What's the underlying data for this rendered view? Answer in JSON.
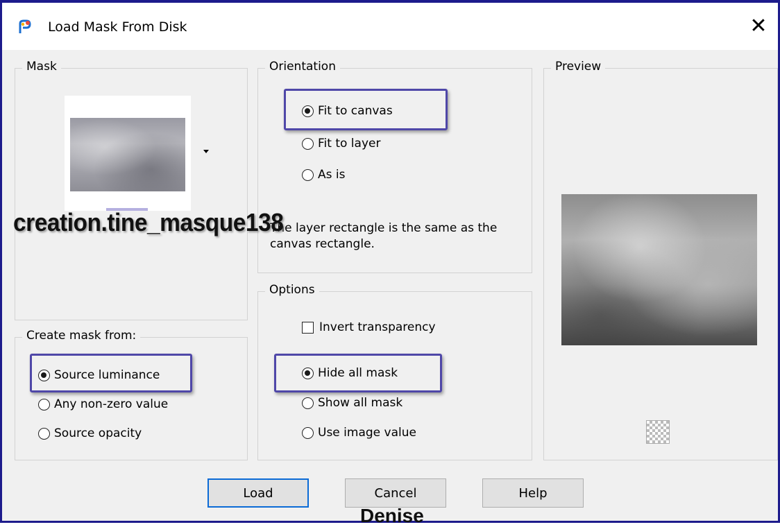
{
  "window": {
    "title": "Load Mask From Disk",
    "close_glyph": "✕",
    "app_icon": "paintshop-pro-icon",
    "border_color": "#1d1b8c"
  },
  "mask_group": {
    "legend": "Mask",
    "mask_name": "creation.tine_masque138"
  },
  "create_from": {
    "legend": "Create mask from:",
    "options": [
      {
        "label": "Source luminance",
        "checked": true
      },
      {
        "label": "Any non-zero value",
        "checked": false
      },
      {
        "label": "Source opacity",
        "checked": false
      }
    ]
  },
  "orientation": {
    "legend": "Orientation",
    "options": [
      {
        "label": "Fit to canvas",
        "checked": true
      },
      {
        "label": "Fit to layer",
        "checked": false
      },
      {
        "label": "As is",
        "checked": false
      }
    ],
    "description": "The layer rectangle is the same as the canvas rectangle."
  },
  "options_group": {
    "legend": "Options",
    "invert_label": "Invert transparency",
    "invert_checked": false,
    "radios": [
      {
        "label": "Hide all mask",
        "checked": true
      },
      {
        "label": "Show all mask",
        "checked": false
      },
      {
        "label": "Use image value",
        "checked": false
      }
    ]
  },
  "preview_group": {
    "legend": "Preview"
  },
  "buttons": {
    "load": "Load",
    "cancel": "Cancel",
    "help": "Help"
  },
  "signature": "Denise",
  "colors": {
    "highlight": "#4f47a8",
    "default_button_border": "#0a6ad6"
  }
}
